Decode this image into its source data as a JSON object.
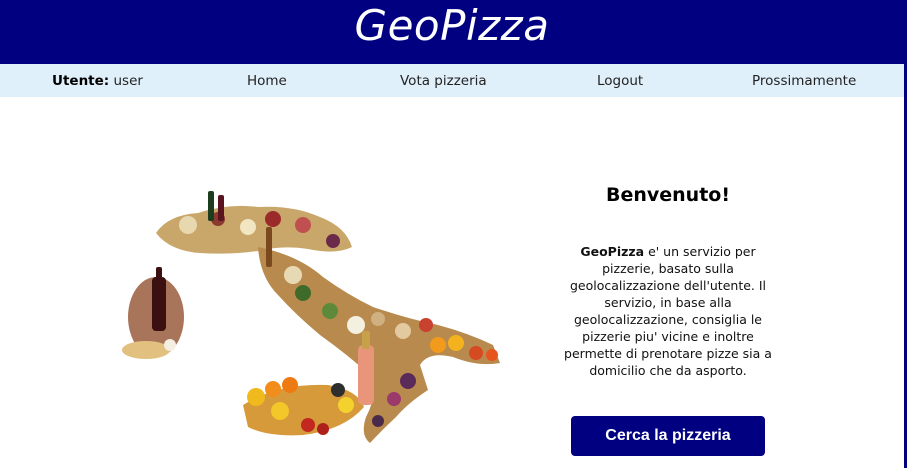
{
  "header": {
    "title": "GeoPizza"
  },
  "nav": {
    "user_label": "Utente:",
    "user_name": "user",
    "items": [
      "Home",
      "Vota pizzeria",
      "Logout",
      "Prossimamente"
    ]
  },
  "illustration": {
    "icon": "italy-food-map-image"
  },
  "welcome": {
    "title": "Benvenuto!",
    "brand": "GeoPizza",
    "text": " e' un servizio per pizzerie, basato sulla geolocalizzazione dell'utente. Il servizio, in base alla geolocalizzazione, consiglia le pizzerie piu' vicine e inoltre permette di prenotare pizze sia a domicilio che da asporto.",
    "button_label": "Cerca la pizzeria"
  },
  "colors": {
    "primary": "#000080",
    "nav_background": "#e0f0fb",
    "button_text": "#ffffff"
  }
}
